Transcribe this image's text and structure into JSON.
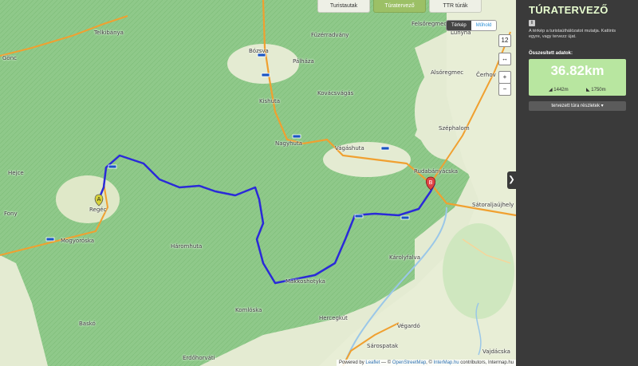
{
  "tabs": [
    {
      "label": "Turistautak"
    },
    {
      "label": "Túratervező"
    },
    {
      "label": "TTR túrák"
    }
  ],
  "layer_toggle": {
    "terkep": "Térkép",
    "muhold": "Műhold"
  },
  "zoom_level": "12",
  "zoom_controls": {
    "fullscreen": "↔",
    "plus": "+",
    "minus": "−"
  },
  "places": {
    "telkibanya": "Telkibánya",
    "fuzerradvany": "Füzérradvány",
    "felsoregmec": "Felsőregmec",
    "goncz": "Gönc",
    "boz": "Bózsva",
    "lunyha": "Lunyha",
    "palhaza": "Pálháza",
    "alsoregmec": "Alsóregmec",
    "cerhov": "Čerhov",
    "kishuta": "Kishuta",
    "kovacsvagas": "Kovácsvágás",
    "szephalom": "Széphalom",
    "hejce": "Hejce",
    "nagyhuta": "Nagyhuta",
    "vagashuta": "Vágáshuta",
    "rudabanyacska": "Rudabányácska",
    "fony": "Fony",
    "regec": "Regéc",
    "satoraljaujhely": "Sátoraljaújhely",
    "mogyoroska": "Mogyoróska",
    "haromhuta": "Háromhuta",
    "karolyfalva": "Károlyfalva",
    "makkoshotyka": "Makkoshotyka",
    "komloska": "Komlóska",
    "hercegkut": "Hercegkút",
    "vegardo": "Végardó",
    "basko": "Baskó",
    "sarospatak": "Sárospatak",
    "erdohorvati": "Erdőhorváti",
    "vajdacska": "Vajdácska"
  },
  "markers": {
    "start": "A",
    "end": "B"
  },
  "attribution": {
    "prefix": "Powered by",
    "leaflet": "Leaflet",
    "sep": " — © ",
    "osm": "OpenStreetMap",
    "mid": ", © ",
    "intermap": "InterMap.hu",
    "suffix": " contributors, Intermap.hu"
  },
  "panel": {
    "title": "TÚRATERVEZŐ",
    "info_icon": "i",
    "hint": "A térkép a turistaúthálózatot mutatja. Kattints egyre, vagy tervezz újat.",
    "summary_label": "Összesített adatok:",
    "distance": "36.82km",
    "ascent": "1442m",
    "descent": "1750m",
    "details_button": "tervezett túra részletek ▾"
  },
  "colors": {
    "route": "#2a2ad8",
    "forest": "#8fc98a",
    "road": "#f0a030",
    "panel_bg": "#3a3a3a",
    "accent": "#9cc066"
  }
}
